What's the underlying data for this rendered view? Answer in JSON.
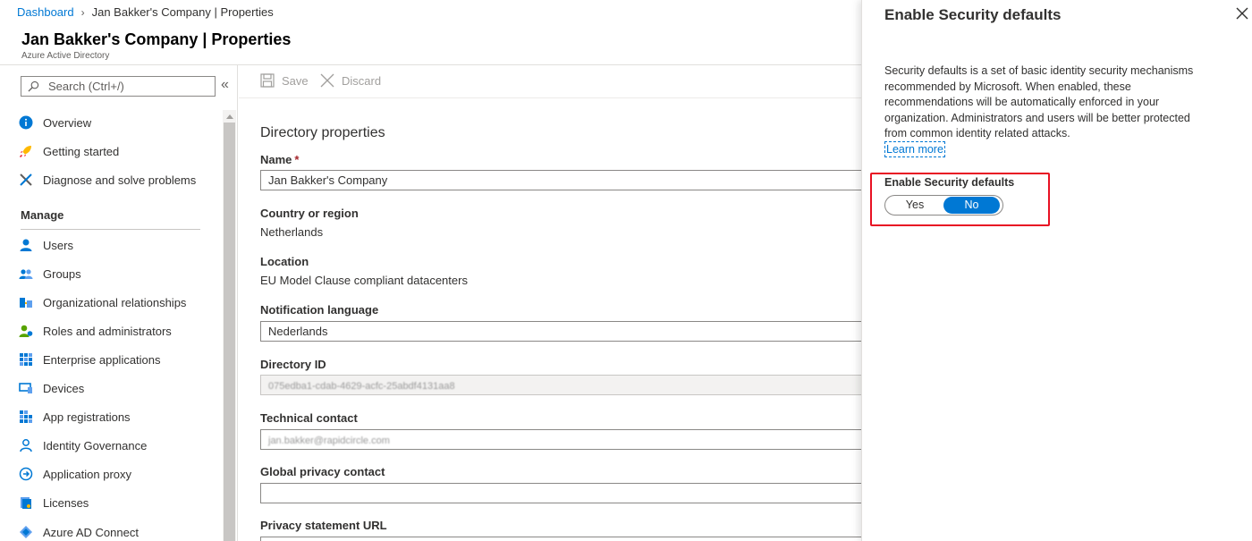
{
  "breadcrumb": {
    "root": "Dashboard",
    "current": "Jan Bakker's Company | Properties"
  },
  "header": {
    "title": "Jan Bakker's Company | Properties",
    "subtitle": "Azure Active Directory"
  },
  "sidebar": {
    "search_placeholder": "Search (Ctrl+/)",
    "collapse_glyph": "«",
    "top_items": [
      {
        "label": "Overview",
        "icon": "info-icon"
      },
      {
        "label": "Getting started",
        "icon": "rocket-icon"
      },
      {
        "label": "Diagnose and solve problems",
        "icon": "wrench-icon"
      }
    ],
    "manage_heading": "Manage",
    "manage_items": [
      {
        "label": "Users",
        "icon": "user-icon"
      },
      {
        "label": "Groups",
        "icon": "groups-icon"
      },
      {
        "label": "Organizational relationships",
        "icon": "org-relationships-icon"
      },
      {
        "label": "Roles and administrators",
        "icon": "roles-icon"
      },
      {
        "label": "Enterprise applications",
        "icon": "enterprise-apps-icon"
      },
      {
        "label": "Devices",
        "icon": "devices-icon"
      },
      {
        "label": "App registrations",
        "icon": "app-registrations-icon"
      },
      {
        "label": "Identity Governance",
        "icon": "identity-governance-icon"
      },
      {
        "label": "Application proxy",
        "icon": "app-proxy-icon"
      },
      {
        "label": "Licenses",
        "icon": "licenses-icon"
      },
      {
        "label": "Azure AD Connect",
        "icon": "ad-connect-icon"
      }
    ]
  },
  "toolbar": {
    "save": "Save",
    "discard": "Discard"
  },
  "main": {
    "section_title": "Directory properties",
    "name_label": "Name",
    "name_required": "*",
    "name_value": "Jan Bakker's Company",
    "country_label": "Country or region",
    "country_value": "Netherlands",
    "location_label": "Location",
    "location_value": "EU Model Clause compliant datacenters",
    "notification_label": "Notification language",
    "notification_value": "Nederlands",
    "directory_id_label": "Directory ID",
    "directory_id_value": "075edba1-cdab-4629-acfc-25abdf4131aa8",
    "technical_contact_label": "Technical contact",
    "technical_contact_value": "jan.bakker@rapidcircle.com",
    "privacy_contact_label": "Global privacy contact",
    "privacy_contact_value": "",
    "privacy_url_label": "Privacy statement URL"
  },
  "panel": {
    "title": "Enable Security defaults",
    "description": "Security defaults is a set of basic identity security mechanisms recommended by Microsoft. When enabled, these recommendations will be automatically enforced in your organization. Administrators and users will be better protected from common identity related attacks.",
    "learn_more": "Learn more",
    "toggle_label": "Enable Security defaults",
    "toggle_yes": "Yes",
    "toggle_no": "No",
    "toggle_selected": "No"
  },
  "colors": {
    "accent": "#0078d4",
    "highlight": "#e81123",
    "required": "#a4262c"
  }
}
